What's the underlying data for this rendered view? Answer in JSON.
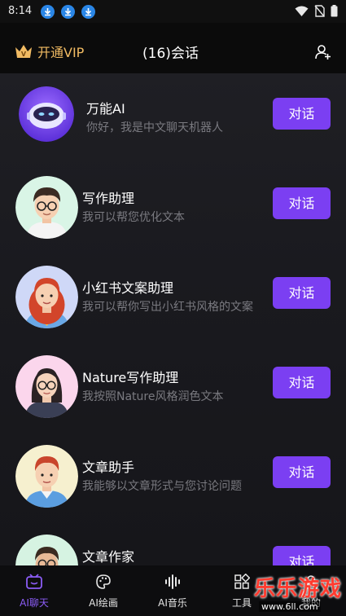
{
  "status_bar": {
    "time": "8:14",
    "icons": [
      "download-icon",
      "download-icon",
      "download-icon",
      "wifi-icon",
      "no-sim-icon",
      "battery-icon"
    ]
  },
  "header": {
    "vip_label": "开通VIP",
    "title": "(16)会话",
    "crown_icon": "crown-icon",
    "add_user_icon": "add-user-icon"
  },
  "colors": {
    "accent": "#7b3ff2",
    "vip_gold": "#f1bb63",
    "tab_active": "#8b5cf6"
  },
  "conversations": [
    {
      "title": "万能AI",
      "desc": "你好，我是中文聊天机器人",
      "button": "对话",
      "avatar": "robot-avatar"
    },
    {
      "title": "写作助理",
      "desc": "我可以帮您优化文本",
      "button": "对话",
      "avatar": "glasses-man-avatar"
    },
    {
      "title": "小红书文案助理",
      "desc": "我可以帮你写出小红书风格的文案",
      "button": "对话",
      "avatar": "red-hair-woman-avatar"
    },
    {
      "title": "Nature写作助理",
      "desc": "我按照Nature风格润色文本",
      "button": "对话",
      "avatar": "glasses-woman-avatar"
    },
    {
      "title": "文章助手",
      "desc": "我能够以文章形式与您讨论问题",
      "button": "对话",
      "avatar": "red-hair-man-avatar"
    },
    {
      "title": "文章作家",
      "desc": "",
      "button": "对话",
      "avatar": "bearded-man-avatar"
    }
  ],
  "tabs": [
    {
      "label": "AI聊天",
      "icon": "chat-icon",
      "active": true
    },
    {
      "label": "AI绘画",
      "icon": "palette-icon",
      "active": false
    },
    {
      "label": "AI音乐",
      "icon": "audio-wave-icon",
      "active": false
    },
    {
      "label": "工具",
      "icon": "grid-tools-icon",
      "active": false
    },
    {
      "label": "我的",
      "icon": "profile-icon",
      "active": false
    }
  ],
  "watermark": {
    "main": "乐乐游戏",
    "sub": "www.6ll.com"
  }
}
